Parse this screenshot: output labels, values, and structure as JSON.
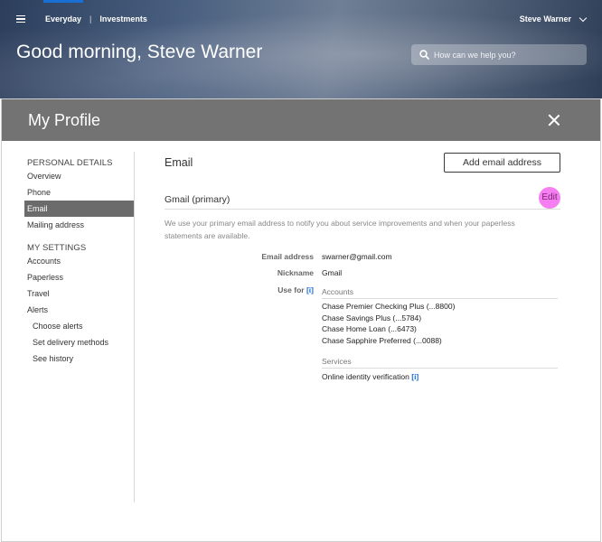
{
  "topbar": {
    "nav_everyday": "Everyday",
    "nav_separator": "|",
    "nav_investments": "Investments",
    "user_name": "Steve Warner"
  },
  "hero": {
    "greeting": "Good morning, Steve Warner",
    "search_placeholder": "How can we help you?"
  },
  "modal": {
    "title": "My Profile"
  },
  "sidebar": {
    "personal_heading": "PERSONAL DETAILS",
    "personal_items": [
      "Overview",
      "Phone",
      "Email",
      "Mailing address"
    ],
    "settings_heading": "MY SETTINGS",
    "settings_items": [
      "Accounts",
      "Paperless",
      "Travel",
      "Alerts"
    ],
    "alerts_sub": [
      "Choose alerts",
      "Set delivery methods",
      "See history"
    ]
  },
  "email": {
    "heading": "Email",
    "add_button": "Add email address",
    "primary_title": "Gmail (primary)",
    "edit_label": "Edit",
    "description": "We use your primary email address to notify you about service improvements and when your paperless statements are available.",
    "fields": {
      "address_label": "Email address",
      "address_value": "swarner@gmail.com",
      "nickname_label": "Nickname",
      "nickname_value": "Gmail",
      "usefor_label": "Use for",
      "info_marker": "[i]"
    },
    "accounts_heading": "Accounts",
    "accounts": [
      "Chase Premier Checking Plus (...8800)",
      "Chase Savings Plus (...5784)",
      "Chase Home Loan (...6473)",
      "Chase Sapphire Preferred (...0088)"
    ],
    "services_heading": "Services",
    "services": [
      "Online identity verification"
    ]
  },
  "colors": {
    "accent": "#1a6fd4",
    "modal_header": "#737373",
    "active_sidebar": "#6b6b6b",
    "edit_highlight": "#f57ef0"
  },
  "icons": [
    "hamburger-icon",
    "chevron-down-icon",
    "search-icon",
    "close-icon",
    "info-icon"
  ]
}
